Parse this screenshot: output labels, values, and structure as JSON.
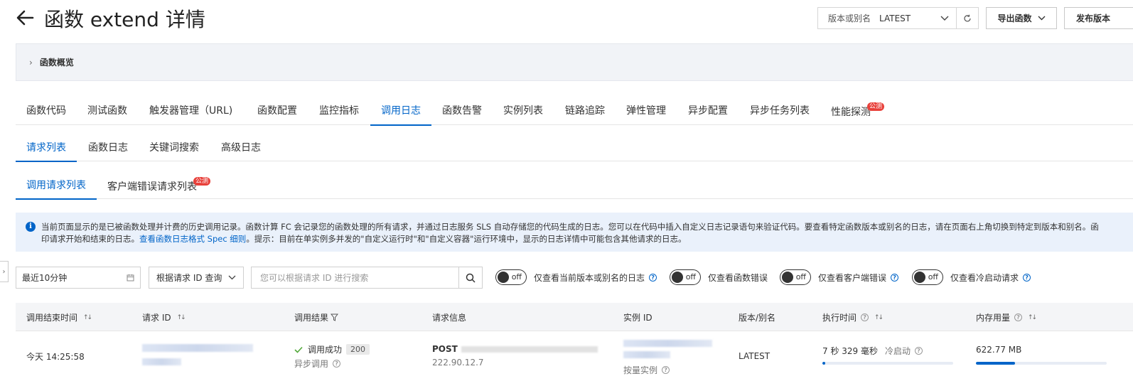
{
  "header": {
    "title": "函数 extend 详情",
    "version_label": "版本或别名",
    "version_value": "LATEST",
    "export_label": "导出函数",
    "publish_label": "发布版本"
  },
  "overview": {
    "label": "函数概览"
  },
  "main_tabs": [
    {
      "label": "函数代码"
    },
    {
      "label": "测试函数"
    },
    {
      "label": "触发器管理（URL)"
    },
    {
      "label": "函数配置"
    },
    {
      "label": "监控指标"
    },
    {
      "label": "调用日志"
    },
    {
      "label": "函数告警"
    },
    {
      "label": "实例列表"
    },
    {
      "label": "链路追踪"
    },
    {
      "label": "弹性管理"
    },
    {
      "label": "异步配置"
    },
    {
      "label": "异步任务列表"
    },
    {
      "label": "性能探测"
    }
  ],
  "beta_badge": "公测",
  "sub_tabs": [
    {
      "label": "请求列表"
    },
    {
      "label": "函数日志"
    },
    {
      "label": "关键词搜索"
    },
    {
      "label": "高级日志"
    }
  ],
  "sub_tabs2": [
    {
      "label": "调用请求列表"
    },
    {
      "label": "客户端错误请求列表"
    }
  ],
  "info": {
    "line1": "当前页面显示的是已被函数处理并计费的历史调用记录。函数计算 FC 会记录您的函数处理的所有请求，并通过日志服务 SLS 自动存储您的代码生成的日志。您可以在代码中插入自定义日志记录语句来验证代码。要查看特定函数版本或别名的日志，请在页面右上角切换到特定到版本和别名。函",
    "line2_prefix": "印请求开始和结束的日志。",
    "line2_link": "查看函数日志格式 Spec 细则",
    "line2_suffix": "。提示：目前在单实例多并发的\"自定义运行时\"和\"自定义容器\"运行环境中，显示的日志详情中可能包含其他请求的日志。"
  },
  "filters": {
    "time_range": "最近10分钟",
    "query_type": "根据请求 ID 查询",
    "search_placeholder": "您可以根据请求 ID 进行搜索",
    "switch_text": "off",
    "toggles": [
      {
        "label": "仅查看当前版本或别名的日志"
      },
      {
        "label": "仅查看函数错误"
      },
      {
        "label": "仅查看客户端错误"
      },
      {
        "label": "仅查看冷启动请求"
      }
    ]
  },
  "table": {
    "headers": {
      "end_time": "调用结束时间",
      "request_id": "请求 ID",
      "result": "调用结果",
      "request_info": "请求信息",
      "instance_id": "实例 ID",
      "version": "版本/别名",
      "exec_time": "执行时间",
      "memory": "内存用量"
    },
    "rows": [
      {
        "end_time": "今天 14:25:58",
        "result": "调用成功",
        "status_code": "200",
        "invoke_type": "异步调用",
        "method": "POST",
        "ip": "222.90.12.7",
        "instance_type": "按量实例",
        "version": "LATEST",
        "exec_time": "7 秒 329 毫秒",
        "cold_start": "冷启动",
        "exec_fraction": 0.02,
        "memory": "622.77 MB",
        "memory_fraction": 0.3
      }
    ]
  },
  "colors": {
    "accent": "#0064c8",
    "badge": "#e8403a",
    "success": "#52a83a"
  }
}
